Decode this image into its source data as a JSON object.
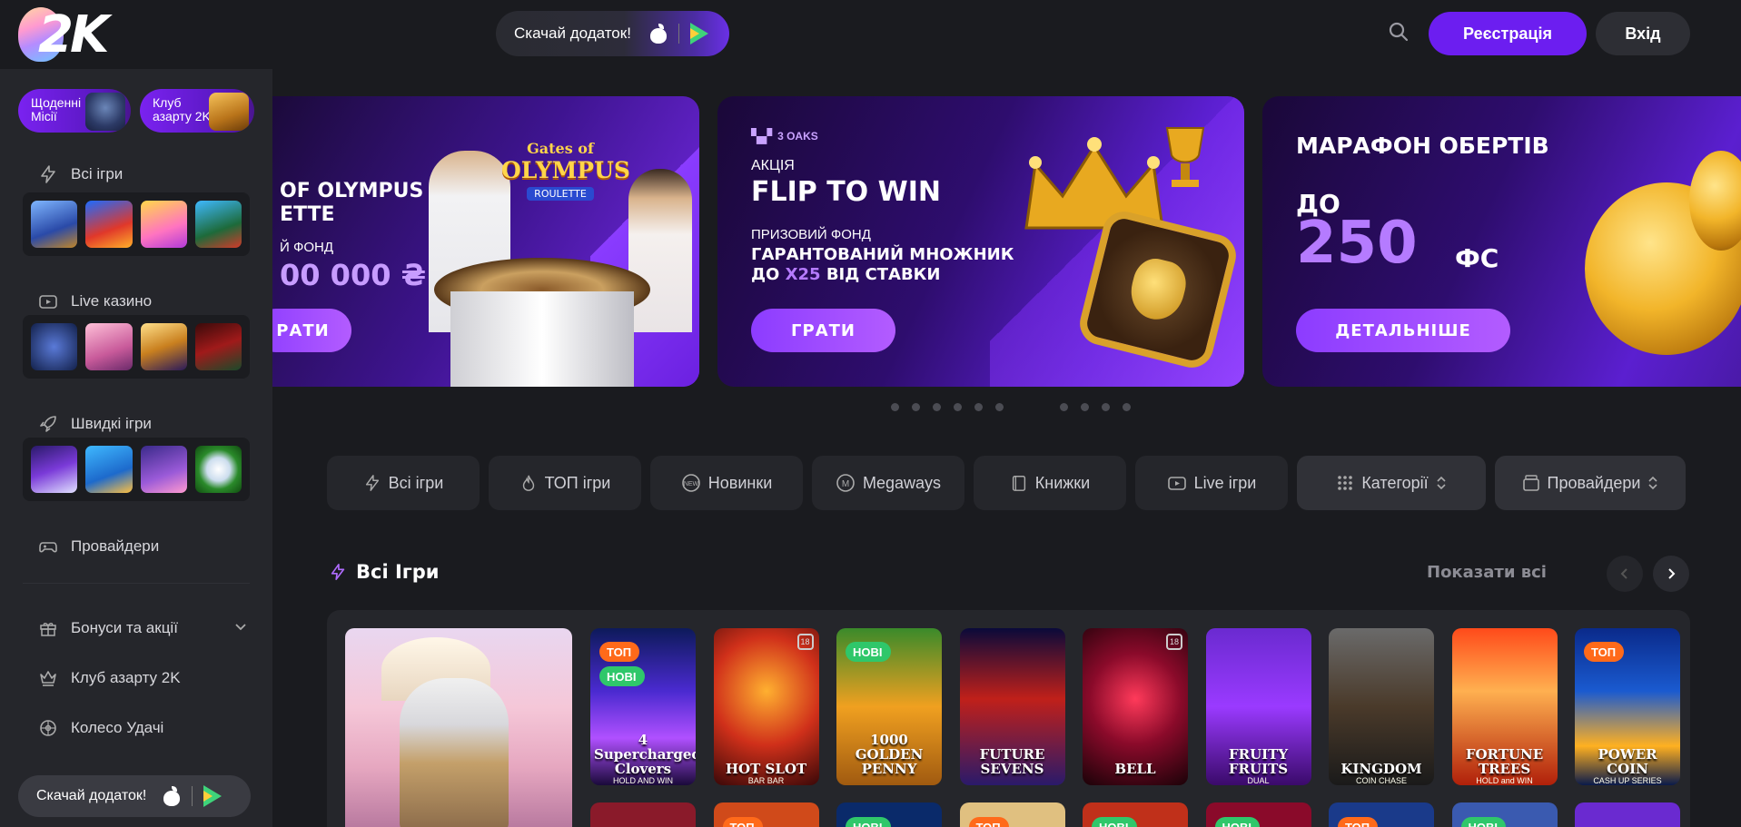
{
  "header": {
    "logo_text": "2K",
    "download_label": "Скачай додаток!",
    "register_label": "Реєстрація",
    "login_label": "Вхід"
  },
  "sidebar": {
    "chips": [
      {
        "label": "Щоденні Місії"
      },
      {
        "label": "Клуб азарту 2K"
      }
    ],
    "sections": [
      {
        "label": "Всі ігри",
        "icon": "lightning-icon"
      },
      {
        "label": "Live казино",
        "icon": "tv-icon"
      },
      {
        "label": "Швидкі ігри",
        "icon": "rocket-icon"
      },
      {
        "label": "Провайдери",
        "icon": "gamepad-icon"
      }
    ],
    "links": [
      {
        "label": "Бонуси та акції",
        "icon": "gift-icon"
      },
      {
        "label": "Клуб азарту 2K",
        "icon": "crown-icon"
      },
      {
        "label": "Колесо Удачі",
        "icon": "wheel-icon"
      }
    ],
    "download_label": "Скачай додаток!"
  },
  "banners": {
    "b1": {
      "title_line1": "OF OLYMPUS",
      "title_line2": "ETTE",
      "logo_line1": "Gates of",
      "logo_line2": "OLYMPUS",
      "logo_line3": "ROULETTE",
      "prize_label": "Й ФОНД",
      "prize_value": "00 000 ₴",
      "button": "РАТИ"
    },
    "b2": {
      "brand": "3 OAKS",
      "tag": "АКЦІЯ",
      "title": "FLIP TO WIN",
      "sub1": "ПРИЗОВИЙ ФОНД",
      "sub2": "ГАРАНТОВАНИЙ МНОЖНИК",
      "sub3_a": "ДО ",
      "sub3_b": "X25",
      "sub3_c": " ВІД СТАВКИ",
      "button": "ГРАТИ"
    },
    "b3": {
      "title": "МАРАФОН ОБЕРТІВ",
      "pre": "ДО",
      "amount": "250",
      "unit": "ФС",
      "button": "ДЕТАЛЬНІШЕ"
    }
  },
  "carousel": {
    "slides": 11,
    "active": 6
  },
  "tabs": [
    {
      "label": "Всі ігри",
      "icon": "lightning-icon"
    },
    {
      "label": "ТОП ігри",
      "icon": "fire-icon"
    },
    {
      "label": "Новинки",
      "icon": "new-icon"
    },
    {
      "label": "Megaways",
      "icon": "megaways-icon"
    },
    {
      "label": "Книжки",
      "icon": "book-icon"
    },
    {
      "label": "Live ігри",
      "icon": "tv-icon"
    },
    {
      "label": "Категорії",
      "icon": "grid-icon"
    },
    {
      "label": "Провайдери",
      "icon": "provider-icon"
    }
  ],
  "all_games": {
    "title": "Всі Ігри",
    "show_all": "Показати всі",
    "games": [
      {
        "name": "4 Supercharged Clovers",
        "sub": "HOLD AND WIN",
        "badges": [
          "ТОП",
          "НОВІ"
        ]
      },
      {
        "name": "HOT SLOT",
        "sub": "BAR BAR",
        "badges": []
      },
      {
        "name": "1000 GOLDEN PENNY",
        "sub": "",
        "badges": [
          "НОВІ"
        ]
      },
      {
        "name": "FUTURE SEVENS",
        "sub": "",
        "badges": []
      },
      {
        "name": "BELL",
        "sub": "",
        "badges": []
      },
      {
        "name": "FRUITY FRUITS",
        "sub": "DUAL",
        "badges": []
      },
      {
        "name": "KINGDOM",
        "sub": "COIN CHASE",
        "badges": []
      },
      {
        "name": "FORTUNE TREES",
        "sub": "HOLD and WIN",
        "badges": []
      },
      {
        "name": "POWER COIN",
        "sub": "CASH UP SERIES",
        "badges": [
          "ТОП"
        ]
      }
    ],
    "row2_badges": [
      "",
      "ТОП",
      "НОВІ",
      "ТОП",
      "НОВІ",
      "НОВІ",
      "ТОП",
      "НОВІ",
      ""
    ]
  },
  "colors": {
    "accent": "#6c1ef0",
    "background": "#1a1b1f",
    "sidebar": "#25262b",
    "top_badge": "#ff6a1a",
    "new_badge": "#2fc76a"
  }
}
